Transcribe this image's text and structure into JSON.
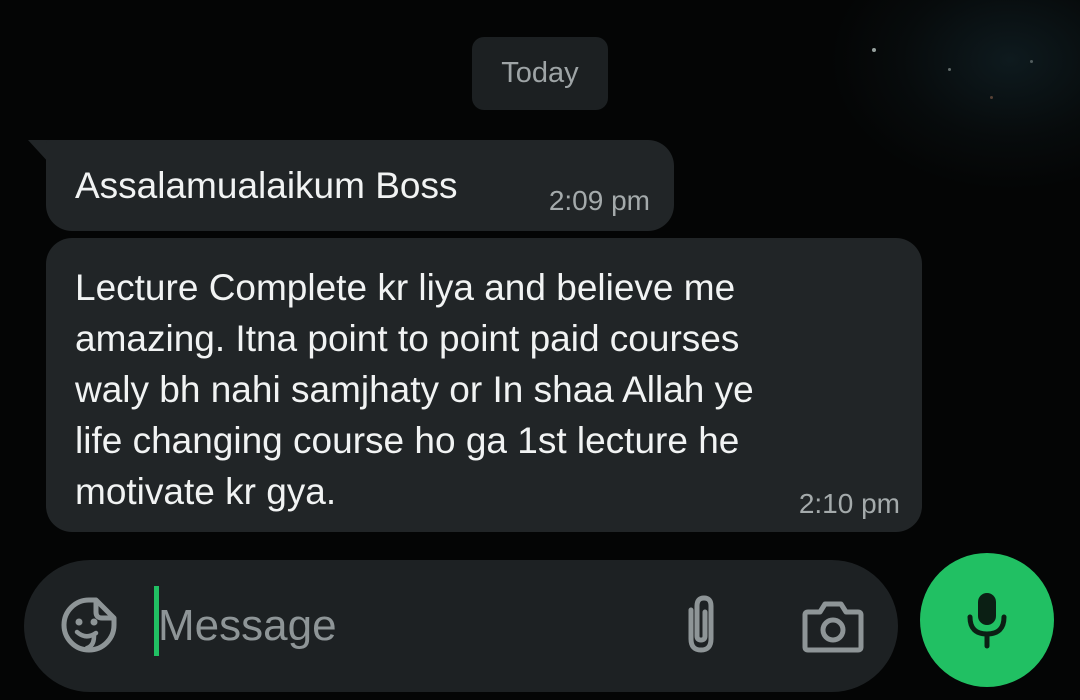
{
  "chat": {
    "date_separator": "Today",
    "messages": [
      {
        "text": "Assalamualaikum Boss",
        "time": "2:09 pm"
      },
      {
        "lines": [
          "Lecture Complete kr liya and believe me",
          "amazing. Itna point to point paid courses",
          "waly bh nahi samjhaty or In shaa Allah ye",
          "life changing course ho ga 1st lecture he",
          "motivate kr gya."
        ],
        "time": "2:10 pm"
      }
    ]
  },
  "composer": {
    "placeholder": "Message",
    "value": "",
    "icons": {
      "emoji": "sticker-emoji-icon",
      "attach": "paperclip-icon",
      "camera": "camera-icon",
      "mic": "microphone-icon"
    }
  },
  "colors": {
    "background": "#050606",
    "bubble": "#212527",
    "accent": "#21c063",
    "text": "#f1f3f3",
    "muted": "#a4aaab"
  }
}
